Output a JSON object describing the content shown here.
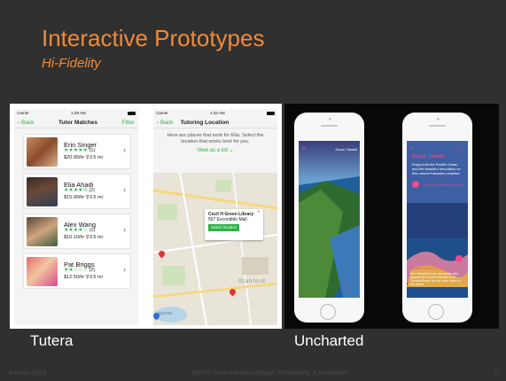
{
  "slide": {
    "title": "Interactive Prototypes",
    "subtitle": "Hi-Fidelity",
    "caption_left": "Tutera",
    "caption_right": "Uncharted",
    "footer_left": "Autumn 2014",
    "footer_center": "HCI+D: User Interface Design, Prototyping, & Evaluation",
    "footer_right": "17"
  },
  "tutor_matches": {
    "carrier": "Carrier",
    "time": "1:29 AM",
    "back": "Back",
    "title": "Tutor Matches",
    "filter": "Filter",
    "rows": [
      {
        "name": "Erin Singer",
        "stars": "★★★★★",
        "count": "(1)",
        "rate": "$20.00/hr",
        "dist": "3.5 mi"
      },
      {
        "name": "Elia Ahadi",
        "stars": "★★★★½",
        "count": "(2)",
        "rate": "$15.00/hr",
        "dist": "3.5 mi"
      },
      {
        "name": "Alex Wang",
        "stars": "★★★★☆",
        "count": "(1)",
        "rate": "$10.10/hr",
        "dist": "3.5 mi"
      },
      {
        "name": "Pat Briggs",
        "stars": "★★☆☆☆",
        "count": "(2)",
        "rate": "$12.50/hr",
        "dist": "3.5 mi"
      }
    ]
  },
  "tutoring_location": {
    "carrier": "Carrier",
    "time": "1:32 AM",
    "back": "Back",
    "title": "Tutoring Location",
    "message": "Here are places that work for Elia. Select the location that works best for you.",
    "view_list": "View as a list",
    "popup_title": "Cecil H Green Library",
    "popup_address": "557 Escondido Mall",
    "popup_button": "Select location",
    "map_label": "Stanford",
    "map_label2": "Lagunita"
  },
  "uncharted": {
    "phone1_place": "Kauai, Hawaii",
    "phone2_place": "Kauai, Hawaii",
    "phone2_desc": "Enjoy both the Pacific Ocean and the beautiful mountains on this natural Hawaiian paradise.",
    "phone2_item1": "Crash at the Beach Hostel",
    "phone2_item2": "Snorkel Tunnels Reef",
    "phone2_item2_desc": "See beautiful coral, sea turtles and tropical fish on this reef just off of Tunnels Beach on the north shore of the island."
  },
  "colors": {
    "accent": "#f28a36",
    "green": "#2db24a",
    "pink": "#f04c8a",
    "background": "#303030"
  }
}
